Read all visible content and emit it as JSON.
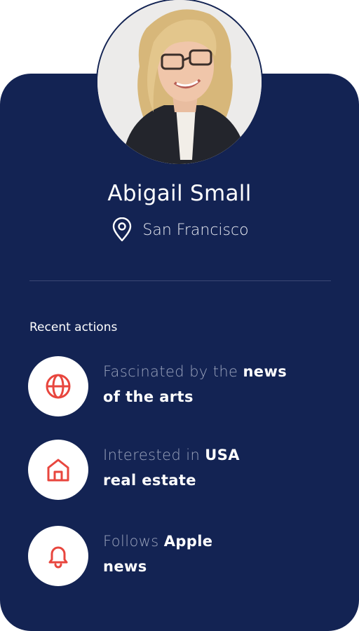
{
  "profile": {
    "name": "Abigail Small",
    "location": "San Francisco"
  },
  "recent_actions": {
    "title": "Recent actions",
    "items": [
      {
        "icon": "globe-icon",
        "light_text": "Fascinated by the ",
        "bold_text_1": "news",
        "bold_text_2": "of the arts"
      },
      {
        "icon": "home-icon",
        "light_text": "Interested in ",
        "bold_text_1": "USA",
        "bold_text_2": "real estate"
      },
      {
        "icon": "bell-icon",
        "light_text": "Follows ",
        "bold_text_1": "Apple",
        "bold_text_2": "news"
      }
    ]
  },
  "colors": {
    "card_background": "#132353",
    "icon_accent": "#e8463e",
    "muted_text": "#9aa3bc"
  }
}
